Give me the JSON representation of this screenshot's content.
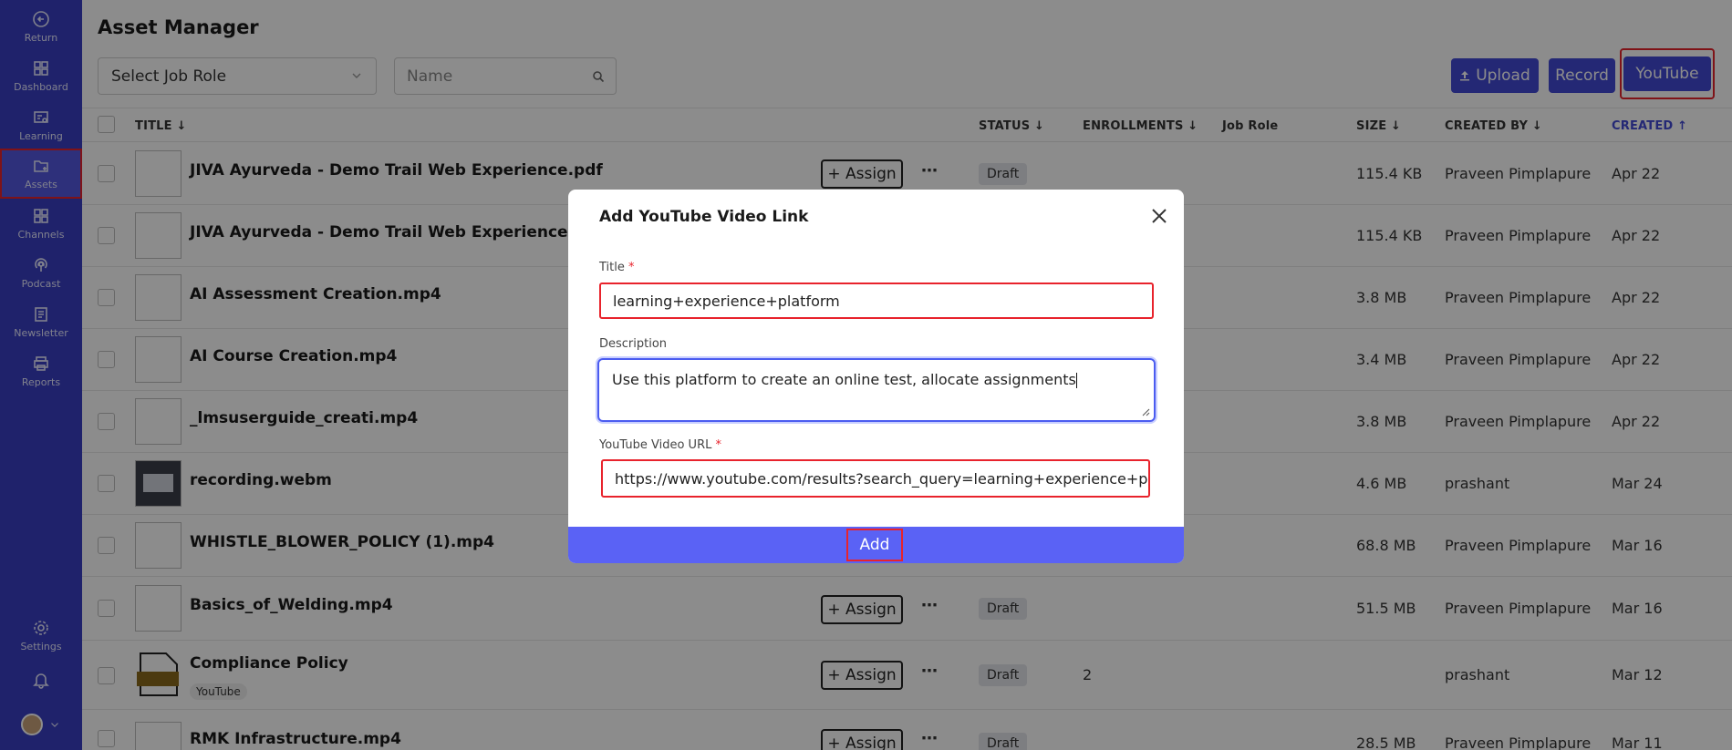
{
  "sidebar": {
    "items": [
      {
        "label": "Return",
        "icon": "return-icon"
      },
      {
        "label": "Dashboard",
        "icon": "dashboard-icon"
      },
      {
        "label": "Learning",
        "icon": "learning-icon"
      },
      {
        "label": "Assets",
        "icon": "assets-icon"
      },
      {
        "label": "Channels",
        "icon": "channels-icon"
      },
      {
        "label": "Podcast",
        "icon": "podcast-icon"
      },
      {
        "label": "Newsletter",
        "icon": "newsletter-icon"
      },
      {
        "label": "Reports",
        "icon": "reports-icon"
      },
      {
        "label": "Settings",
        "icon": "gear-icon"
      }
    ]
  },
  "header": {
    "title": "Asset Manager",
    "job_role_placeholder": "Select Job Role",
    "name_placeholder": "Name",
    "upload_label": "Upload",
    "record_label": "Record",
    "youtube_label": "YouTube"
  },
  "columns": {
    "title": "TITLE",
    "status": "STATUS",
    "enrollments": "ENROLLMENTS",
    "job_role": "Job Role",
    "size": "SIZE",
    "created_by": "CREATED BY",
    "created": "CREATED"
  },
  "assign_label": "+ Assign",
  "draft_label": "Draft",
  "rows": [
    {
      "title": "JIVA Ayurveda - Demo Trail Web Experience.pdf",
      "size": "115.4 KB",
      "creator": "Praveen Pimplapure",
      "created": "Apr 22"
    },
    {
      "title": "JIVA Ayurveda - Demo Trail Web Experience.pdf",
      "size": "115.4 KB",
      "creator": "Praveen Pimplapure",
      "created": "Apr 22"
    },
    {
      "title": "AI Assessment Creation.mp4",
      "size": "3.8 MB",
      "creator": "Praveen Pimplapure",
      "created": "Apr 22"
    },
    {
      "title": "AI Course Creation.mp4",
      "size": "3.4 MB",
      "creator": "Praveen Pimplapure",
      "created": "Apr 22"
    },
    {
      "title": "_lmsuserguide_creati.mp4",
      "size": "3.8 MB",
      "creator": "Praveen Pimplapure",
      "created": "Apr 22"
    },
    {
      "title": "recording.webm",
      "size": "4.6 MB",
      "creator": "prashant",
      "created": "Mar 24"
    },
    {
      "title": "WHISTLE_BLOWER_POLICY (1).mp4",
      "size": "68.8 MB",
      "creator": "Praveen Pimplapure",
      "created": "Mar 16"
    },
    {
      "title": "Basics_of_Welding.mp4",
      "size": "51.5 MB",
      "creator": "Praveen Pimplapure",
      "created": "Mar 16"
    },
    {
      "title": "Compliance Policy",
      "tag": "YouTube",
      "enrollments": "2",
      "size": "",
      "creator": "prashant",
      "created": "Mar 12"
    },
    {
      "title": "RMK Infrastructure.mp4",
      "size": "28.5 MB",
      "creator": "Praveen Pimplapure",
      "created": "Mar 11"
    }
  ],
  "modal": {
    "title": "Add YouTube Video Link",
    "title_label": "Title",
    "title_value": "learning+experience+platform",
    "description_label": "Description",
    "description_value": "Use this platform to create an online test, allocate assignments",
    "url_label": "YouTube Video URL",
    "url_value": "https://www.youtube.com/results?search_query=learning+experience+platform",
    "required_mark": "*",
    "add_label": "Add"
  },
  "colors": {
    "sidebar": "#3a3ec4",
    "primary": "#4349d6",
    "add_bar": "#5a62f5",
    "highlight": "#e8232c"
  }
}
